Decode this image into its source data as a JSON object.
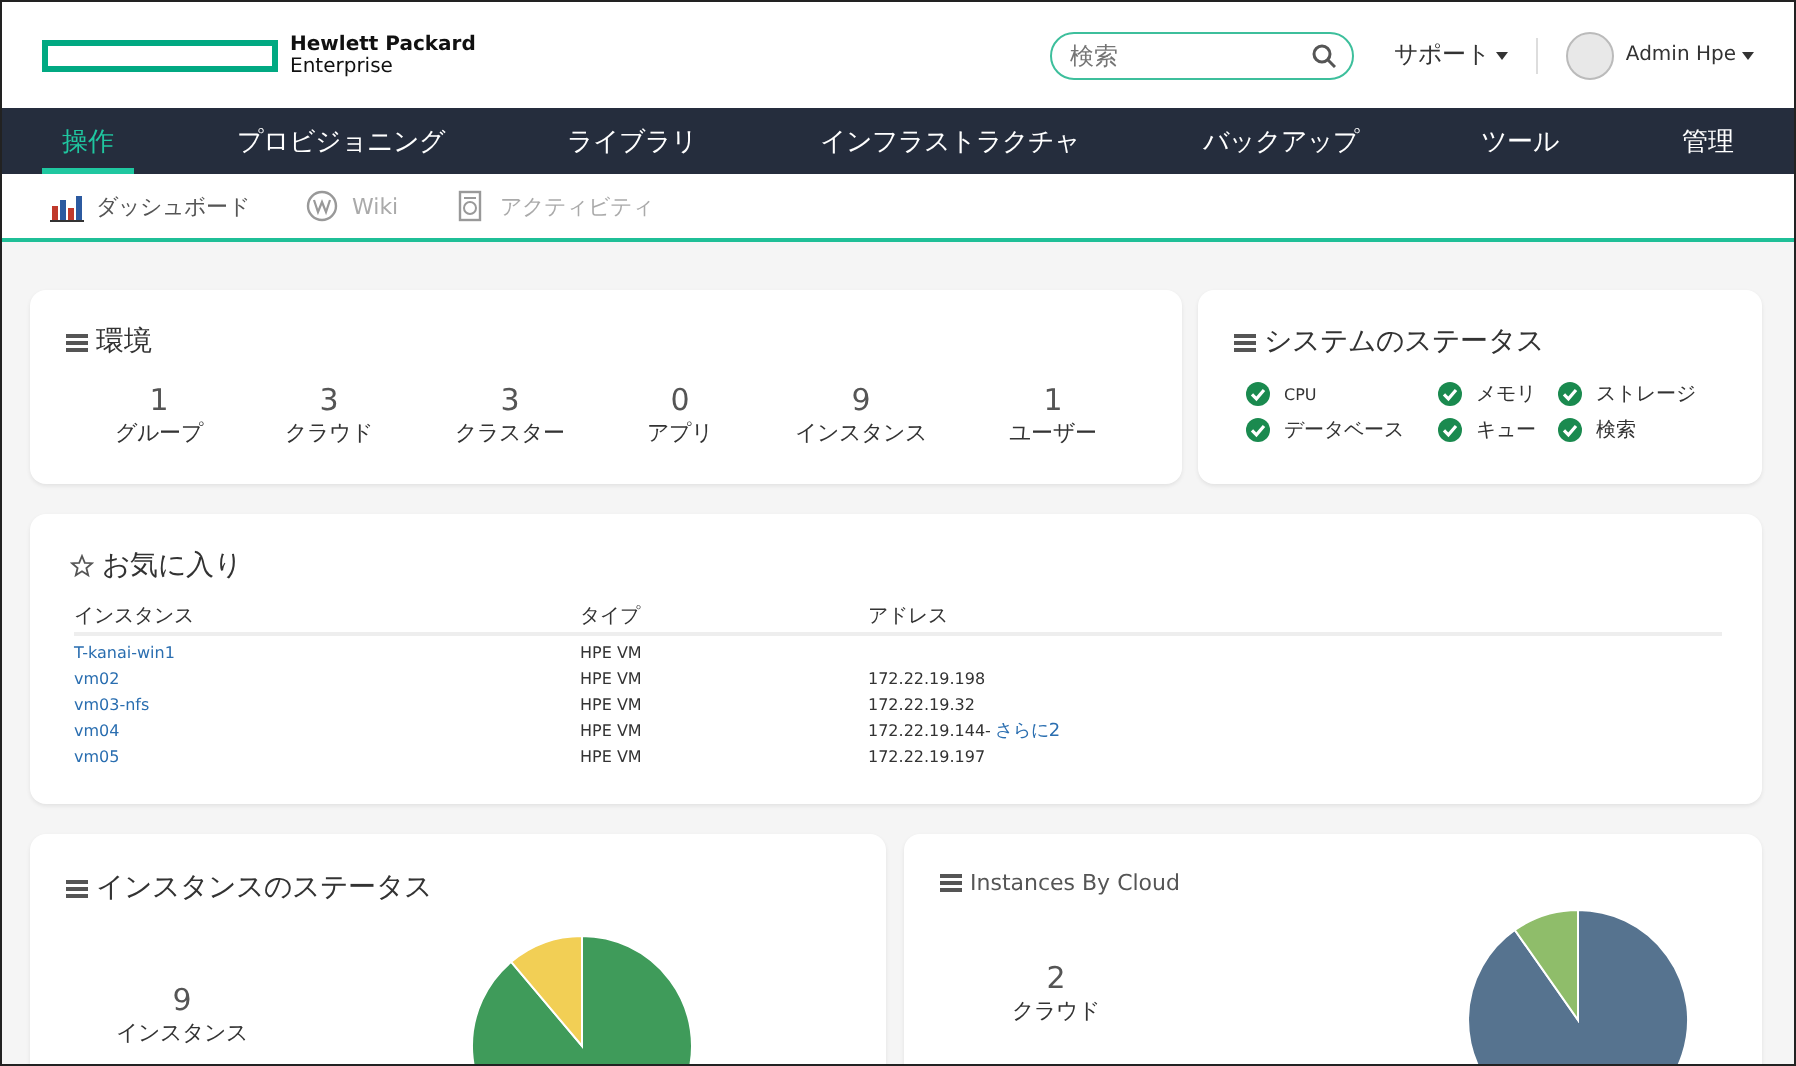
{
  "header": {
    "logo_line1": "Hewlett Packard",
    "logo_line2": "Enterprise",
    "search": {
      "placeholder": "検索"
    },
    "support": "サポート",
    "user": "Admin Hpe"
  },
  "nav": [
    {
      "label": "操作",
      "selected": true
    },
    {
      "label": "プロビジョニング",
      "selected": false
    },
    {
      "label": "ライブラリ",
      "selected": false
    },
    {
      "label": "インフラストラクチャ",
      "selected": false
    },
    {
      "label": "バックアップ",
      "selected": false
    },
    {
      "label": "ツール",
      "selected": false
    },
    {
      "label": "管理",
      "selected": false
    }
  ],
  "subnav": [
    {
      "label": "ダッシュボード",
      "kind": "chart",
      "selected": true
    },
    {
      "label": "Wiki",
      "kind": "wiki",
      "selected": false
    },
    {
      "label": "アクティビティ",
      "kind": "activity",
      "selected": false
    }
  ],
  "environment": {
    "title": "環境",
    "stats": [
      {
        "value": "1",
        "label": "グループ"
      },
      {
        "value": "3",
        "label": "クラウド"
      },
      {
        "value": "3",
        "label": "クラスター"
      },
      {
        "value": "0",
        "label": "アプリ"
      },
      {
        "value": "9",
        "label": "インスタンス"
      },
      {
        "value": "1",
        "label": "ユーザー"
      }
    ]
  },
  "system_status": {
    "title": "システムのステータス",
    "items": [
      {
        "label": "CPU",
        "ok": true
      },
      {
        "label": "メモリ",
        "ok": true
      },
      {
        "label": "ストレージ",
        "ok": true
      },
      {
        "label": "データベース",
        "ok": true
      },
      {
        "label": "キュー",
        "ok": true
      },
      {
        "label": "検索",
        "ok": true
      }
    ]
  },
  "favorites": {
    "title": "お気に入り",
    "columns": [
      "インスタンス",
      "タイプ",
      "アドレス"
    ],
    "rows": [
      {
        "instance": "T-kanai-win1",
        "type": "HPE VM"
      },
      {
        "instance": "vm02",
        "type": "HPE VM",
        "address": "172.22.19.198"
      },
      {
        "instance": "vm03-nfs",
        "type": "HPE VM",
        "address": "172.22.19.32"
      },
      {
        "instance": "vm04",
        "type": "HPE VM",
        "address": "172.22.19.144-",
        "more": "さらに2"
      },
      {
        "instance": "vm05",
        "type": "HPE VM",
        "address": "172.22.19.197"
      }
    ]
  },
  "panels": [
    {
      "title": "インスタンスのステータス",
      "count": "9",
      "unit": "インスタンス",
      "kind": "status"
    },
    {
      "title": "Instances By Cloud",
      "count": "2",
      "unit": "クラウド",
      "kind": "cloud"
    }
  ]
}
